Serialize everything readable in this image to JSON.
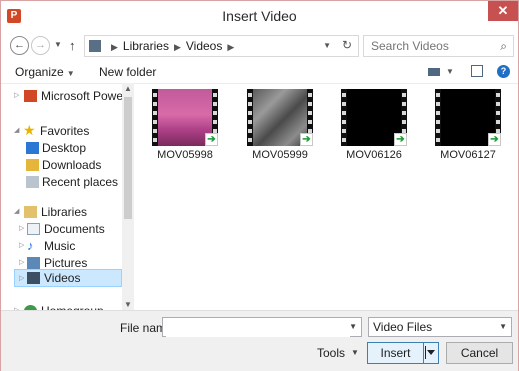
{
  "window": {
    "title": "Insert Video",
    "app_icon": "P",
    "close_glyph": "✕"
  },
  "nav": {
    "back_glyph": "←",
    "forward_glyph": "→",
    "up_glyph": "↑",
    "breadcrumb": [
      "Libraries",
      "Videos"
    ],
    "search_placeholder": "Search Videos"
  },
  "commands": {
    "organize": "Organize",
    "new_folder": "New folder",
    "help_glyph": "?"
  },
  "sidebar": {
    "items": [
      {
        "label": "Microsoft PowerPoint",
        "icon": "powerpoint-icon",
        "expandable": true
      },
      {
        "label": "Favorites",
        "icon": "star-icon",
        "expanded": true
      },
      {
        "label": "Desktop",
        "icon": "desktop-icon"
      },
      {
        "label": "Downloads",
        "icon": "downloads-icon"
      },
      {
        "label": "Recent places",
        "icon": "recent-places-icon"
      },
      {
        "label": "Libraries",
        "icon": "libraries-icon",
        "expanded": true
      },
      {
        "label": "Documents",
        "icon": "documents-icon",
        "expandable": true
      },
      {
        "label": "Music",
        "icon": "music-icon",
        "expandable": true
      },
      {
        "label": "Pictures",
        "icon": "pictures-icon",
        "expandable": true
      },
      {
        "label": "Videos",
        "icon": "videos-icon",
        "expandable": true,
        "selected": true
      },
      {
        "label": "Homegroup",
        "icon": "homegroup-icon",
        "expandable": true
      }
    ]
  },
  "files": [
    {
      "name": "MOV05998",
      "thumbnail": "pink"
    },
    {
      "name": "MOV05999",
      "thumbnail": "gray-crowd"
    },
    {
      "name": "MOV06126",
      "thumbnail": "black"
    },
    {
      "name": "MOV06127",
      "thumbnail": "black"
    }
  ],
  "footer": {
    "file_name_label": "File name:",
    "file_name_value": "",
    "file_type": "Video Files",
    "tools": "Tools",
    "insert": "Insert",
    "cancel": "Cancel"
  },
  "colors": {
    "accent": "#1f6fc5",
    "close": "#c75050",
    "selection": "#cce8ff"
  }
}
